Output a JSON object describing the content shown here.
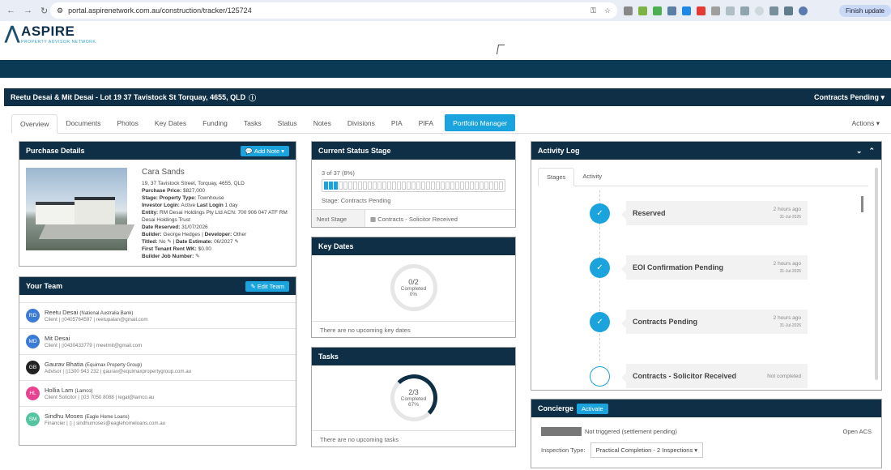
{
  "browser": {
    "url": "portal.aspirenetwork.com.au/construction/tracker/125724",
    "finish_update": "Finish update"
  },
  "brand": {
    "name": "ASPIRE",
    "tagline": "PROPERTY ADVISOR NETWORK"
  },
  "header": {
    "title": "Reetu Desai & Mit Desai - Lot 19 37 Tavistock St Torquay, 4655, QLD",
    "status": "Contracts Pending"
  },
  "tabs": [
    "Overview",
    "Documents",
    "Photos",
    "Key Dates",
    "Funding",
    "Tasks",
    "Status",
    "Notes",
    "Divisions",
    "PIA",
    "PIFA"
  ],
  "portfolio_manager": "Portfolio Manager",
  "actions": "Actions",
  "purchase": {
    "title": "Purchase Details",
    "add_note": "Add Note",
    "name": "Cara Sands",
    "address": "19, 37 Tavistock Street, Torquay, 4655, QLD",
    "purchase_price_label": "Purchase Price:",
    "purchase_price": "$827,000",
    "stage_label": "Stage:",
    "stage": "Property Type:",
    "property_type": "Townhouse",
    "investor_login_label": "Investor Login:",
    "investor_login": "Active",
    "last_login_label": "Last Login",
    "last_login": "1 day",
    "entity_label": "Entity:",
    "entity": "RM Desai Holdings Pty Ltd ACN: 700 906 047 ATF RM Desai Holdings Trust",
    "date_reserved_label": "Date Reserved:",
    "date_reserved": "31/07/2026",
    "builder_label": "Builder:",
    "builder": "George Hedges",
    "developer_label": "Developer:",
    "developer": "Other",
    "titled_label": "Titled:",
    "titled": "No",
    "date_estimate_label": "Date Estimate:",
    "date_estimate": "06/2027",
    "first_rent_label": "First Tenant Rent WK:",
    "first_rent": "$0.00",
    "builder_job_label": "Builder Job Number:"
  },
  "team": {
    "title": "Your Team",
    "edit": "Edit Team",
    "members": [
      {
        "initials": "RD",
        "color": "#3a7bd5",
        "name": "Reetu Desai",
        "org": "(National Australia Bank)",
        "role": "Client",
        "phone": "0405764597",
        "email": "reetupalan@gmail.com"
      },
      {
        "initials": "MD",
        "color": "#3a7bd5",
        "name": "Mit Desai",
        "org": "",
        "role": "Client",
        "phone": "0430433779",
        "email": "meetmit@gmail.com"
      },
      {
        "initials": "GB",
        "color": "#222222",
        "name": "Gaurav Bhatia",
        "org": "(Equimax Property Group)",
        "role": "Advisor",
        "phone": "1300 943 232",
        "email": "gaurav@equimaxpropertygroup.com.au"
      },
      {
        "initials": "HL",
        "color": "#e84393",
        "name": "Hollia Lam",
        "org": "(Lamco)",
        "role": "Client Solicitor",
        "phone": "03 7050 8088",
        "email": "legal@lamco.au"
      },
      {
        "initials": "SM",
        "color": "#55c4a0",
        "name": "Sindhu Moses",
        "org": "(Eagle Home Loans)",
        "role": "Financier",
        "phone": "",
        "email": "sindhumoses@eaglehomeloans.com.au"
      }
    ]
  },
  "status_stage": {
    "title": "Current Status Stage",
    "progress_text": "3 of 37 (8%)",
    "progress_fraction": 0.08,
    "total_steps": 37,
    "done_steps": 3,
    "stage_text": "Stage: Contracts Pending",
    "next_label": "Next Stage",
    "next_value": "Contracts - Solicitor Received"
  },
  "key_dates": {
    "title": "Key Dates",
    "count": "0/2",
    "label": "Completed",
    "pct": "0%",
    "fraction": 0,
    "empty": "There are no upcoming key dates"
  },
  "tasks": {
    "title": "Tasks",
    "count": "2/3",
    "label": "Completed",
    "pct": "67%",
    "fraction": 0.67,
    "empty": "There are no upcoming tasks"
  },
  "activity": {
    "title": "Activity Log",
    "tab_stages": "Stages",
    "tab_activity": "Activity",
    "stages": [
      {
        "name": "Reserved",
        "time": "2 hours ago",
        "date": "31-Jul-2026",
        "done": true
      },
      {
        "name": "EOI Confirmation Pending",
        "time": "2 hours ago",
        "date": "31-Jul-2026",
        "done": true
      },
      {
        "name": "Contracts Pending",
        "time": "2 hours ago",
        "date": "31-Jul-2026",
        "done": true
      },
      {
        "name": "Contracts - Solicitor Received",
        "time": "Not completed",
        "date": "",
        "done": false
      }
    ]
  },
  "concierge": {
    "title": "Concierge",
    "badge": "Activate",
    "status": "Not triggered (settlement pending)",
    "open": "Open ACS",
    "inspection_label": "Inspection Type:",
    "inspection_value": "Practical Completion - 2 Inspections"
  }
}
